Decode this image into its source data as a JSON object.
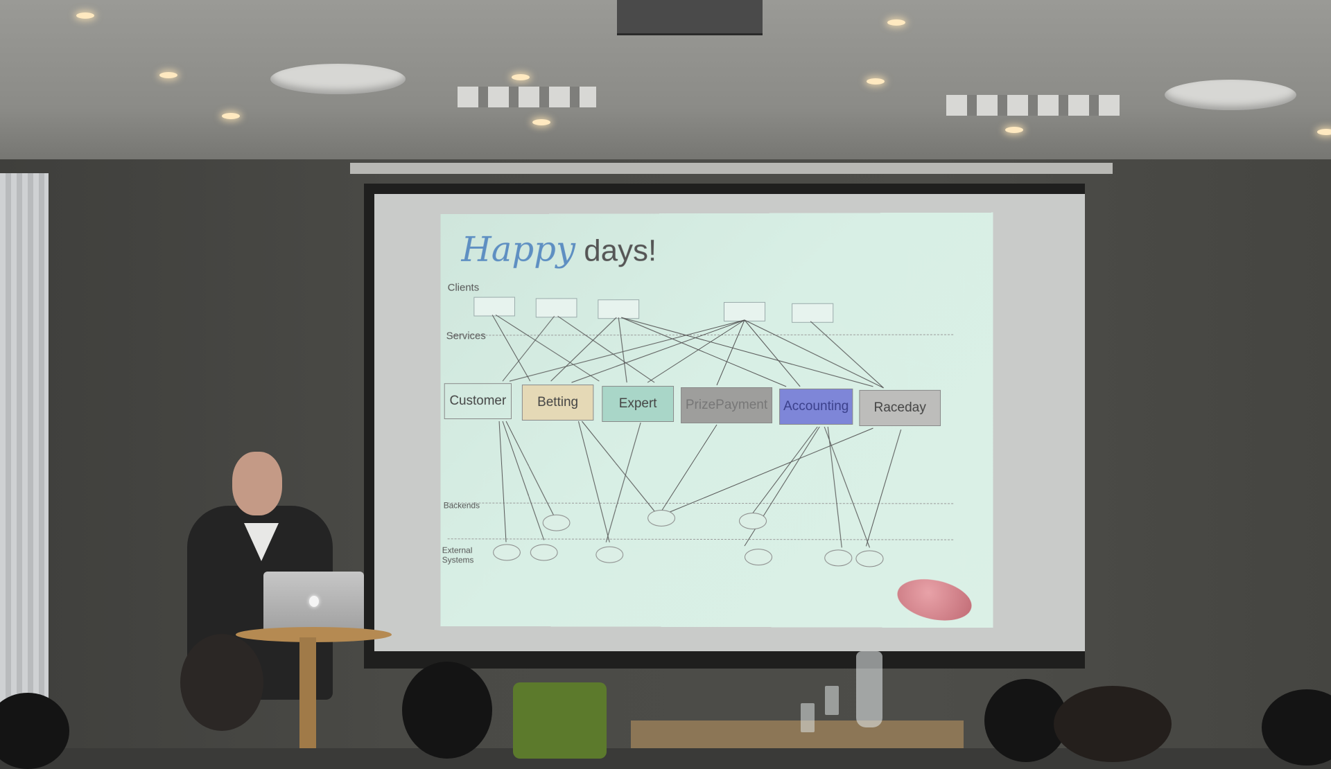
{
  "scene": "presentation",
  "slide": {
    "title_script": "Happy",
    "title_rest": "days!",
    "lanes": {
      "clients": "Clients",
      "services": "Services",
      "backends": "Backends",
      "external": "External Systems"
    },
    "services": [
      {
        "label": "Customer",
        "color": "#c6c9c8"
      },
      {
        "label": "Betting",
        "color": "#e5d9b6"
      },
      {
        "label": "Expert",
        "color": "#a9d6c8"
      },
      {
        "label": "PrizePayment",
        "color": "#9e9e9c"
      },
      {
        "label": "Accounting",
        "color": "#7e86d8"
      },
      {
        "label": "Raceday",
        "color": "#bdbdbb"
      }
    ]
  }
}
